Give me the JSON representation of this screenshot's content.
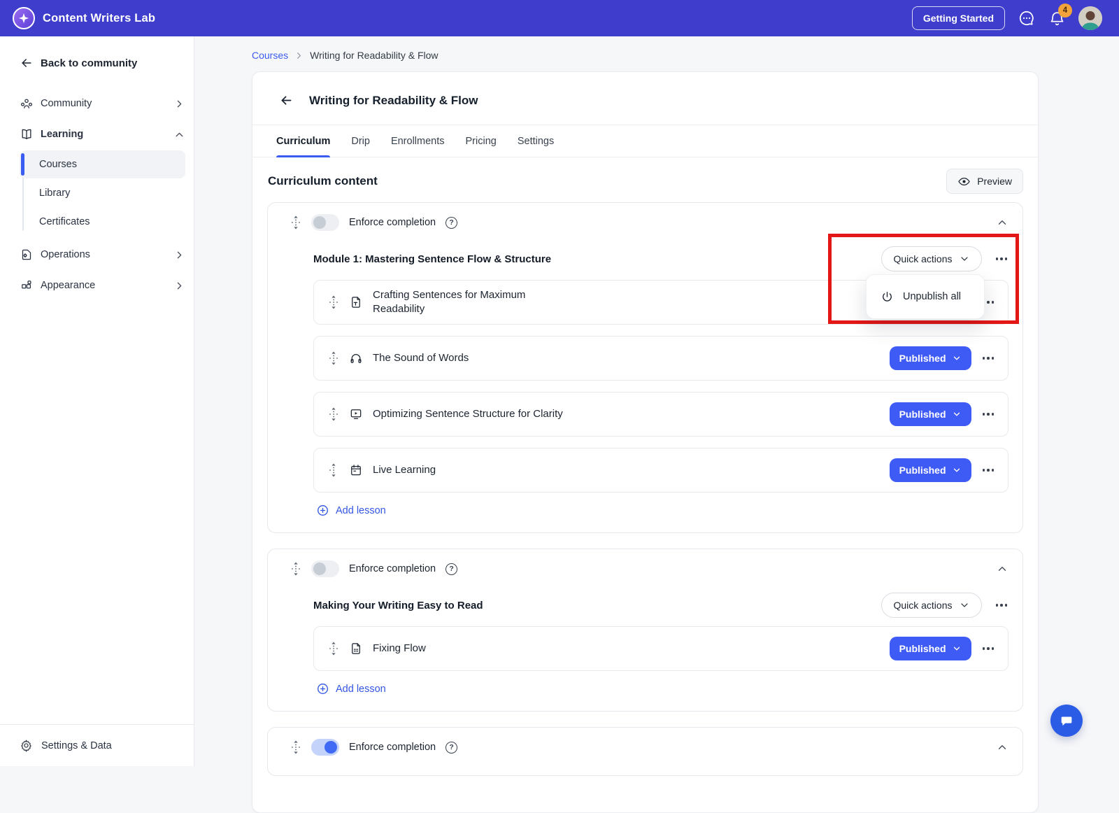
{
  "colors": {
    "navbar_bg": "#3f3dcb",
    "accent_blue": "#3b5cf0",
    "published_blue": "#3f5bf5",
    "annotation_red": "#e41717",
    "badge_orange": "#f2a33c"
  },
  "navbar": {
    "brand": "Content Writers Lab",
    "getting_started": "Getting Started",
    "notification_count": "4",
    "icons": [
      "sparkle-logo-icon",
      "messenger-icon",
      "bell-icon",
      "avatar"
    ]
  },
  "sidebar": {
    "back": "Back to community",
    "community": "Community",
    "learning": "Learning",
    "courses": "Courses",
    "library": "Library",
    "certificates": "Certificates",
    "operations": "Operations",
    "appearance": "Appearance",
    "settings": "Settings & Data",
    "active_item": "Courses"
  },
  "breadcrumb": {
    "parent": "Courses",
    "current": "Writing for Readability & Flow"
  },
  "course": {
    "title": "Writing for Readability & Flow",
    "tabs": [
      "Curriculum",
      "Drip",
      "Enrollments",
      "Pricing",
      "Settings"
    ],
    "active_tab": "Curriculum",
    "heading": "Curriculum content",
    "preview": "Preview"
  },
  "labels": {
    "enforce": "Enforce completion",
    "quick_actions": "Quick actions",
    "published": "Published",
    "add_lesson": "Add lesson",
    "unpublish_all": "Unpublish all"
  },
  "modules": [
    {
      "title": "Module 1: Mastering Sentence Flow & Structure",
      "enforce_on": false,
      "lessons": [
        {
          "title": "Crafting Sentences for Maximum Readability",
          "icon": "text-lesson-icon"
        },
        {
          "title": "The Sound of Words",
          "icon": "audio-lesson-icon",
          "status": "Published"
        },
        {
          "title": "Optimizing Sentence Structure for Clarity",
          "icon": "video-lesson-icon",
          "status": "Published"
        },
        {
          "title": "Live Learning",
          "icon": "calendar-lesson-icon",
          "status": "Published"
        }
      ]
    },
    {
      "title": "Making Your Writing Easy to Read",
      "enforce_on": false,
      "lessons": [
        {
          "title": "Fixing Flow",
          "icon": "document-lesson-icon",
          "status": "Published"
        }
      ]
    },
    {
      "enforce_on": true,
      "lessons": []
    }
  ]
}
